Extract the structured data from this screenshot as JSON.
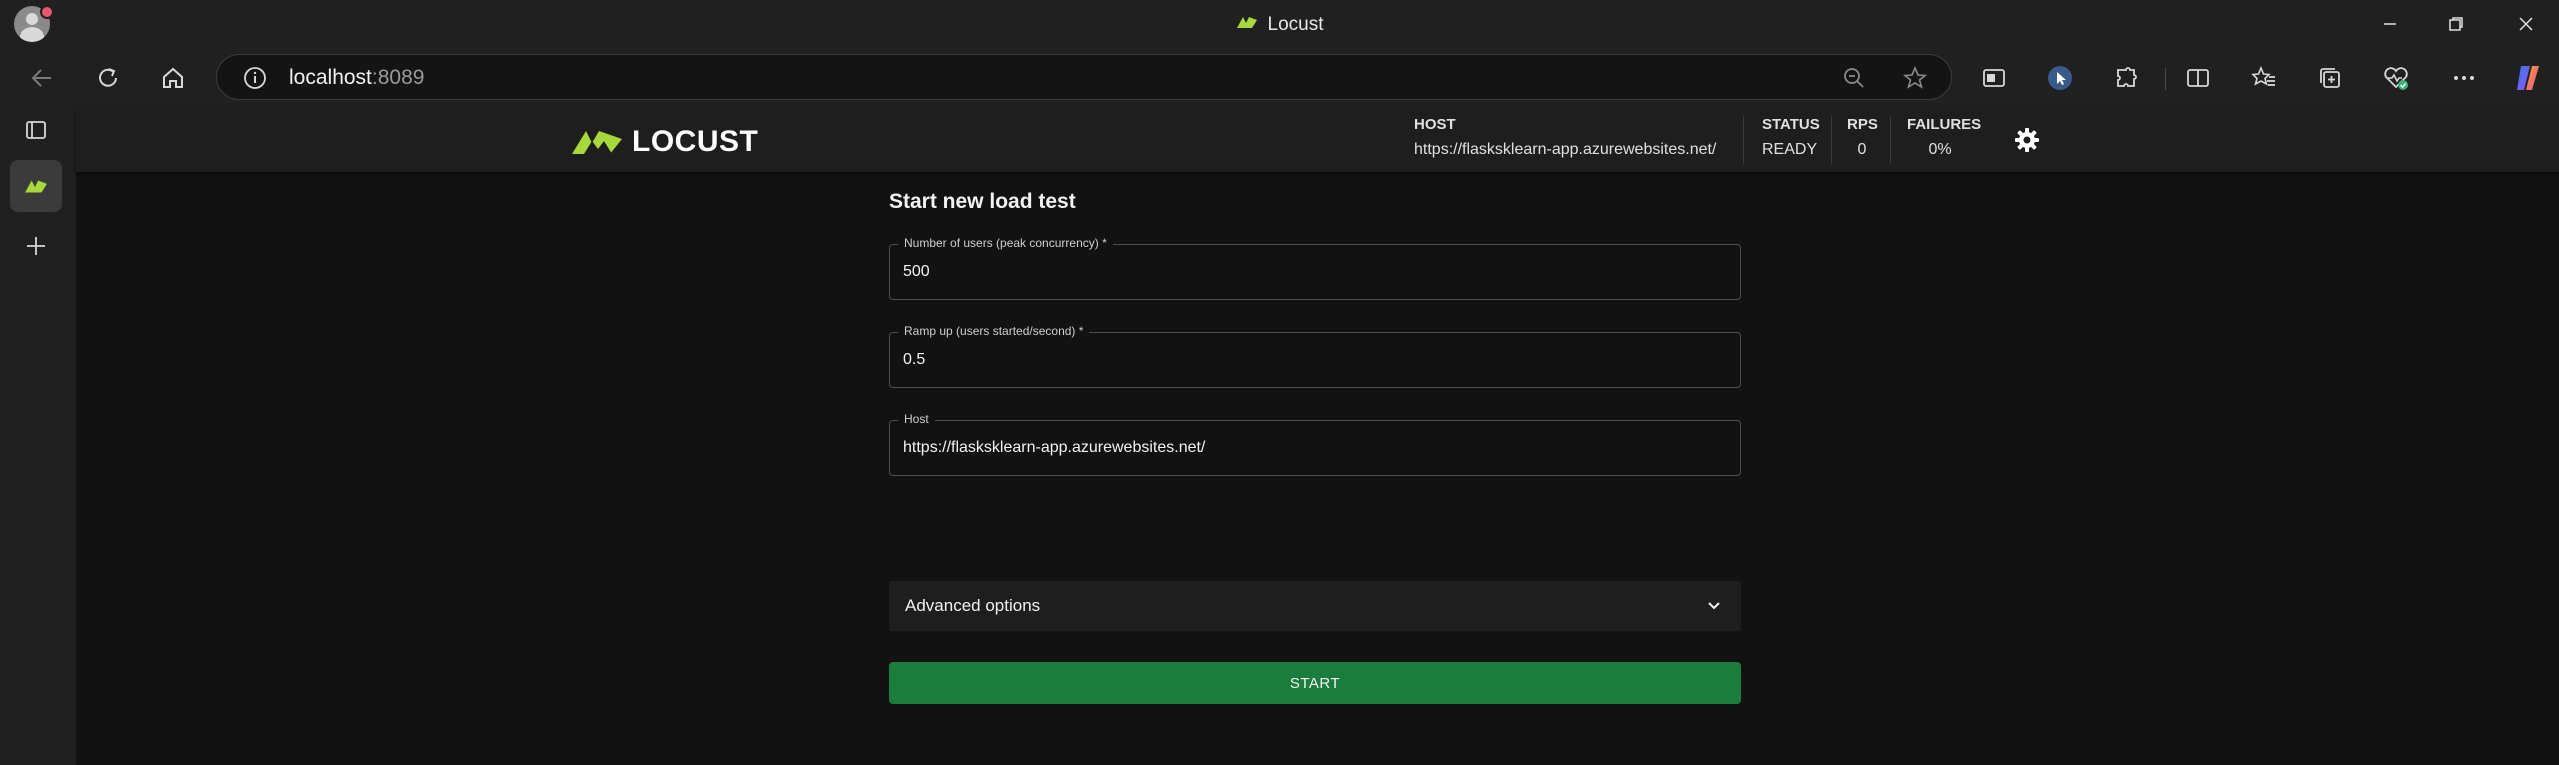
{
  "window": {
    "title": "Locust"
  },
  "browser": {
    "url_host": "localhost",
    "url_port": ":8089"
  },
  "app": {
    "logo_text": "LOCUST",
    "stats": {
      "host_label": "HOST",
      "host_value": "https://flasksklearn-app.azurewebsites.net/",
      "status_label": "STATUS",
      "status_value": "READY",
      "rps_label": "RPS",
      "rps_value": "0",
      "failures_label": "FAILURES",
      "failures_value": "0%"
    },
    "form": {
      "title": "Start new load test",
      "users_label": "Number of users (peak concurrency) *",
      "users_value": "500",
      "ramp_label": "Ramp up (users started/second) *",
      "ramp_value": "0.5",
      "host_label": "Host",
      "host_value": "https://flasksklearn-app.azurewebsites.net/",
      "advanced_label": "Advanced options",
      "start_label": "START"
    }
  },
  "colors": {
    "logo_green": "#a7d93a",
    "start_button": "#1a7d3c"
  }
}
